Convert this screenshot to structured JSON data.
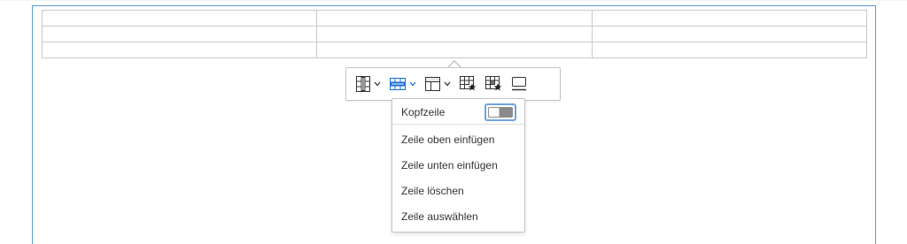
{
  "table": {
    "rows": [
      [
        "",
        "",
        ""
      ],
      [
        "",
        "",
        ""
      ],
      [
        "",
        "",
        ""
      ]
    ]
  },
  "toolbar": {
    "buttons": [
      {
        "icon": "table-column-icon",
        "has_dropdown": true
      },
      {
        "icon": "table-row-icon",
        "has_dropdown": true,
        "active": true
      },
      {
        "icon": "table-merge-cells-icon",
        "has_dropdown": true
      },
      {
        "icon": "table-properties-icon",
        "has_dropdown": false
      },
      {
        "icon": "table-cell-properties-icon",
        "has_dropdown": false
      },
      {
        "icon": "table-caption-icon",
        "has_dropdown": false
      }
    ],
    "active_color": "#1a6ed8"
  },
  "row_menu": {
    "header_row_label": "Kopfzeile",
    "header_row_toggle": "on",
    "items": [
      "Zeile oben einfügen",
      "Zeile unten einfügen",
      "Zeile löschen",
      "Zeile auswählen"
    ]
  }
}
